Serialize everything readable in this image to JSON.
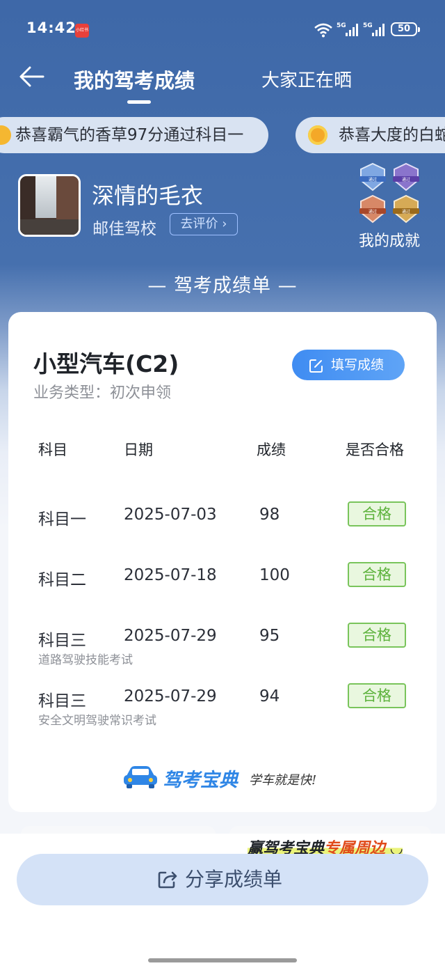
{
  "status_bar": {
    "time": "14:42",
    "app_icon_text": "小红书",
    "network_label_1": "5G",
    "network_label_2": "5G",
    "battery": "50"
  },
  "header": {
    "title": "我的驾考成绩",
    "other_tab": "大家正在晒"
  },
  "ticker": [
    "恭喜霸气的香草97分通过科目一",
    "恭喜大度的白蛇"
  ],
  "profile": {
    "nickname": "深情的毛衣",
    "school": "邮佳驾校",
    "rate_button": "去评价",
    "achievements_label": "我的成就",
    "badge_caption": "通过"
  },
  "section_title": "— 驾考成绩单 —",
  "card": {
    "car_type": "小型汽车(C2)",
    "business_type": "业务类型：初次申领",
    "fill_button": "填写成绩",
    "columns": [
      "科目",
      "日期",
      "成绩",
      "是否合格"
    ],
    "rows": [
      {
        "subject": "科目一",
        "subtitle": "",
        "date": "2025-07-03",
        "score": "98",
        "status": "合格"
      },
      {
        "subject": "科目二",
        "subtitle": "",
        "date": "2025-07-18",
        "score": "100",
        "status": "合格"
      },
      {
        "subject": "科目三",
        "subtitle": "道路驾驶技能考试",
        "date": "2025-07-29",
        "score": "95",
        "status": "合格"
      },
      {
        "subject": "科目三",
        "subtitle": "安全文明驾驶常识考试",
        "date": "2025-07-29",
        "score": "94",
        "status": "合格"
      }
    ],
    "brand_name": "驾考宝典",
    "brand_slogan": "学车就是快!"
  },
  "promo": {
    "prefix": "赢驾考宝典",
    "highlight": "专属周边"
  },
  "share_button": "分享成绩单",
  "colors": {
    "header_bg": "#3e68a8",
    "accent_blue": "#3f8cf2",
    "pass_green": "#5cb23b",
    "share_bg": "#d4e2f7"
  }
}
